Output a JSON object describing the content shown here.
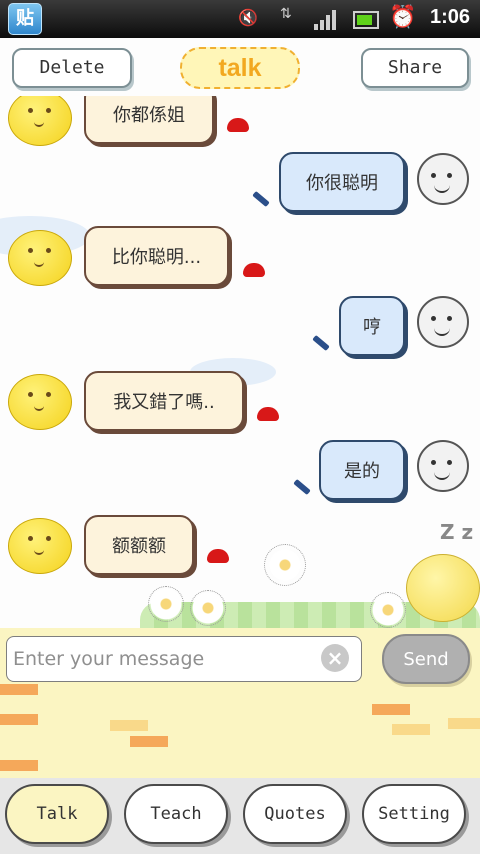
{
  "status_bar": {
    "app_icon_text": "贴",
    "clock": "1:06"
  },
  "top_bar": {
    "delete_label": "Delete",
    "title": "talk",
    "share_label": "Share"
  },
  "messages": [
    {
      "side": "left",
      "text": "你都係姐"
    },
    {
      "side": "right",
      "text": "你很聪明"
    },
    {
      "side": "left",
      "text": "比你聪明..."
    },
    {
      "side": "right",
      "text": "哼"
    },
    {
      "side": "left",
      "text": "我又錯了嗎.."
    },
    {
      "side": "right",
      "text": "是的"
    },
    {
      "side": "left",
      "text": "额额额"
    }
  ],
  "sleep_text": "Z z",
  "input": {
    "placeholder": "Enter your message",
    "value": "",
    "send_label": "Send"
  },
  "tabs": [
    {
      "label": "Talk",
      "active": true
    },
    {
      "label": "Teach",
      "active": false
    },
    {
      "label": "Quotes",
      "active": false
    },
    {
      "label": "Setting",
      "active": false
    }
  ],
  "colors": {
    "accent": "#f2a820",
    "input_bg": "#fbf5c2",
    "left_bubble": "#fdf3dc",
    "right_bubble": "#d9e9fb"
  }
}
